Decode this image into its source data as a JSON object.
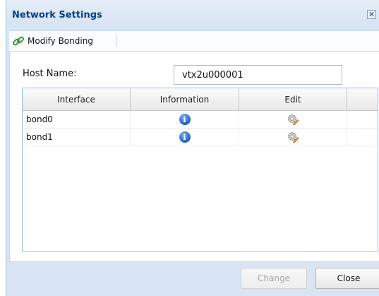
{
  "window": {
    "title": "Network Settings",
    "close_glyph": "✕"
  },
  "toolbar": {
    "modify_bonding_label": "Modify Bonding",
    "modify_bonding_icon": "link-icon"
  },
  "form": {
    "host_label": "Host Name:",
    "host_value": "vtx2u000001"
  },
  "grid": {
    "columns": [
      "Interface",
      "Information",
      "Edit",
      ""
    ],
    "rows": [
      {
        "interface": "bond0",
        "info_icon": "info-icon",
        "edit_icon": "gear-edit-icon"
      },
      {
        "interface": "bond1",
        "info_icon": "info-icon",
        "edit_icon": "gear-edit-icon"
      }
    ]
  },
  "footer": {
    "change_label": "Change",
    "close_label": "Close"
  },
  "colors": {
    "title_text": "#04408c",
    "dialog_bg": "#d9e5f4",
    "border": "#99bce8"
  }
}
